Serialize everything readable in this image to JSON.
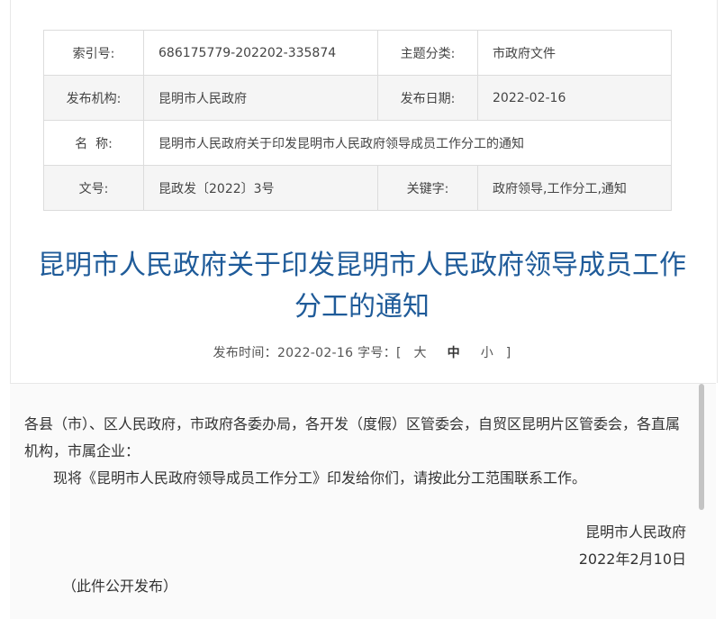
{
  "meta": {
    "rows": [
      {
        "l1": "索引号:",
        "v1": "686175779-202202-335874",
        "l2": "主题分类:",
        "v2": "市政府文件"
      },
      {
        "l1": "发布机构:",
        "v1": "昆明市人民政府",
        "l2": "发布日期:",
        "v2": "2022-02-16"
      },
      {
        "l1": "名  称:",
        "v1": "昆明市人民政府关于印发昆明市人民政府领导成员工作分工的通知"
      },
      {
        "l1": "文号:",
        "v1": "昆政发〔2022〕3号",
        "l2": "关键字:",
        "v2": "政府领导,工作分工,通知"
      }
    ]
  },
  "title": "昆明市人民政府关于印发昆明市人民政府领导成员工作分工的通知",
  "pub": {
    "label": "发布时间：",
    "date": "2022-02-16",
    "fontsize_label": "字号：[",
    "sizes": [
      "大",
      "中",
      "小"
    ],
    "close": "]"
  },
  "body": {
    "p1": "各县（市）、区人民政府，市政府各委办局，各开发（度假）区管委会，自贸区昆明片区管委会，各直属机构，市属企业：",
    "p2": "现将《昆明市人民政府领导成员工作分工》印发给你们，请按此分工范围联系工作。",
    "signer": "昆明市人民政府",
    "date": "2022年2月10日",
    "note": "（此件公开发布）"
  },
  "colors": {
    "title": "#1f5b99",
    "zebra": "#f5f5f5",
    "border": "#dcdcdc"
  }
}
